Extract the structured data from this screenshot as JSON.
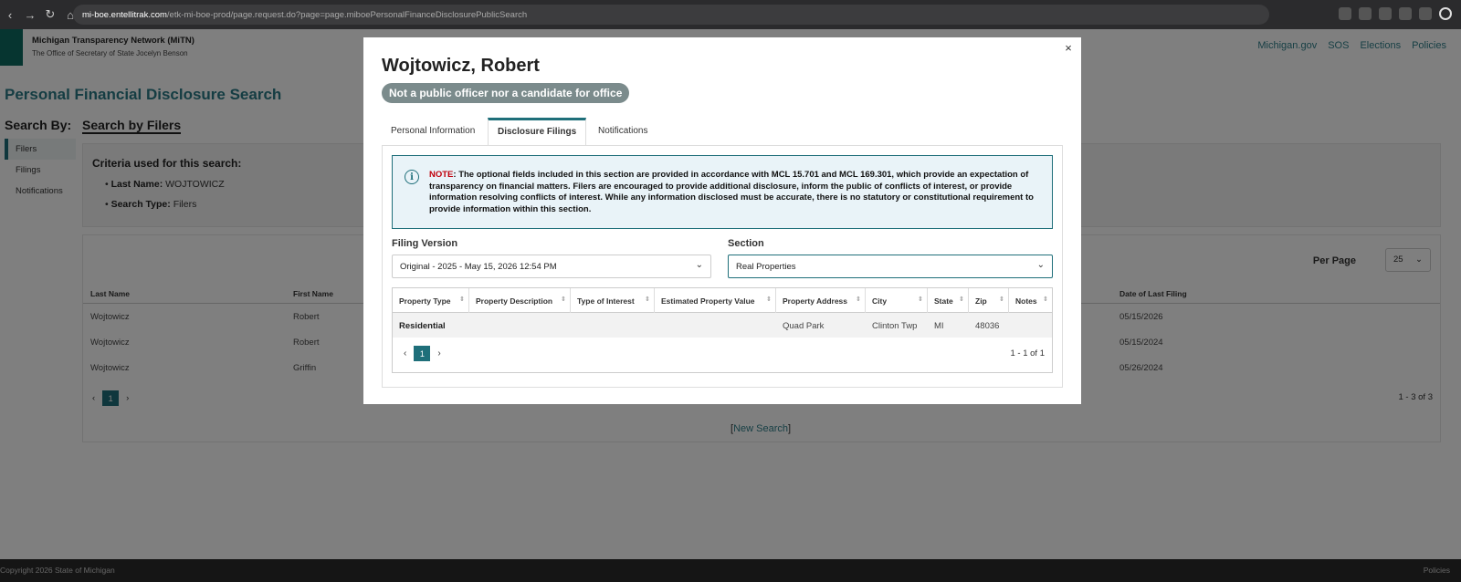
{
  "browser": {
    "url_host": "mi-boe.entellitrak.com",
    "url_path": "/etk-mi-boe-prod/page.request.do?page=page.miboePersonalFinanceDisclosurePublicSearch"
  },
  "site": {
    "title": "Michigan Transparency Network (MiTN)",
    "subtitle": "The Office of Secretary of State Jocelyn Benson",
    "links": [
      "Michigan.gov",
      "SOS",
      "Elections",
      "Policies"
    ]
  },
  "page": {
    "title": "Personal Financial Disclosure Search",
    "search_by": "Search By:",
    "search_mode": "Search by Filers",
    "side_nav": [
      "Filers",
      "Filings",
      "Notifications"
    ],
    "criteria_title": "Criteria used for this search:",
    "criteria": [
      {
        "label": "Last Name:",
        "value": "WOJTOWICZ"
      },
      {
        "label": "Search Type:",
        "value": "Filers"
      }
    ],
    "per_page_label": "Per Page",
    "per_page_value": "25",
    "columns": [
      "Last Name",
      "First Name",
      "Date of Last Filing"
    ],
    "rows": [
      {
        "last": "Wojtowicz",
        "first": "Robert",
        "date": "05/15/2026"
      },
      {
        "last": "Wojtowicz",
        "first": "Robert",
        "date": "05/15/2024"
      },
      {
        "last": "Wojtowicz",
        "first": "Griffin",
        "date": "05/26/2024"
      }
    ],
    "current_page": "1",
    "result_count": "1 - 3 of 3",
    "new_search": "New Search",
    "footer_copy": "Copyright 2026 State of Michigan",
    "footer_policies": "Policies"
  },
  "modal": {
    "title": "Wojtowicz, Robert",
    "status": "Not a public officer nor a candidate for office",
    "tabs": [
      "Personal Information",
      "Disclosure Filings",
      "Notifications"
    ],
    "note_label": "NOTE",
    "note_text": ": The optional fields included in this section are provided in accordance with MCL 15.701 and MCL 169.301, which provide an expectation of transparency on financial matters. Filers are encouraged to provide additional disclosure, inform the public of conflicts of interest, or provide information resolving conflicts of interest. While any information disclosed must be accurate, there is no statutory or constitutional requirement to provide information within this section.",
    "filing_version_label": "Filing Version",
    "filing_version_value": "Original - 2025 - May 15, 2026 12:54 PM",
    "section_label": "Section",
    "section_value": "Real Properties",
    "grid_columns": [
      "Property Type",
      "Property Description",
      "Type of Interest",
      "Estimated Property Value",
      "Property Address",
      "City",
      "State",
      "Zip",
      "Notes"
    ],
    "grid_row": {
      "type": "Residential",
      "description": "",
      "interest": "",
      "value": "",
      "address": "Quad Park",
      "city": "Clinton Twp",
      "state": "MI",
      "zip": "48036",
      "notes": ""
    },
    "current_page": "1",
    "count": "1 - 1 of 1",
    "close_symbol": "×"
  },
  "colors": {
    "accent": "#1f6f7a",
    "link": "#2f7f8a",
    "note_red": "#c0000c",
    "badge": "#7b8b8c"
  }
}
